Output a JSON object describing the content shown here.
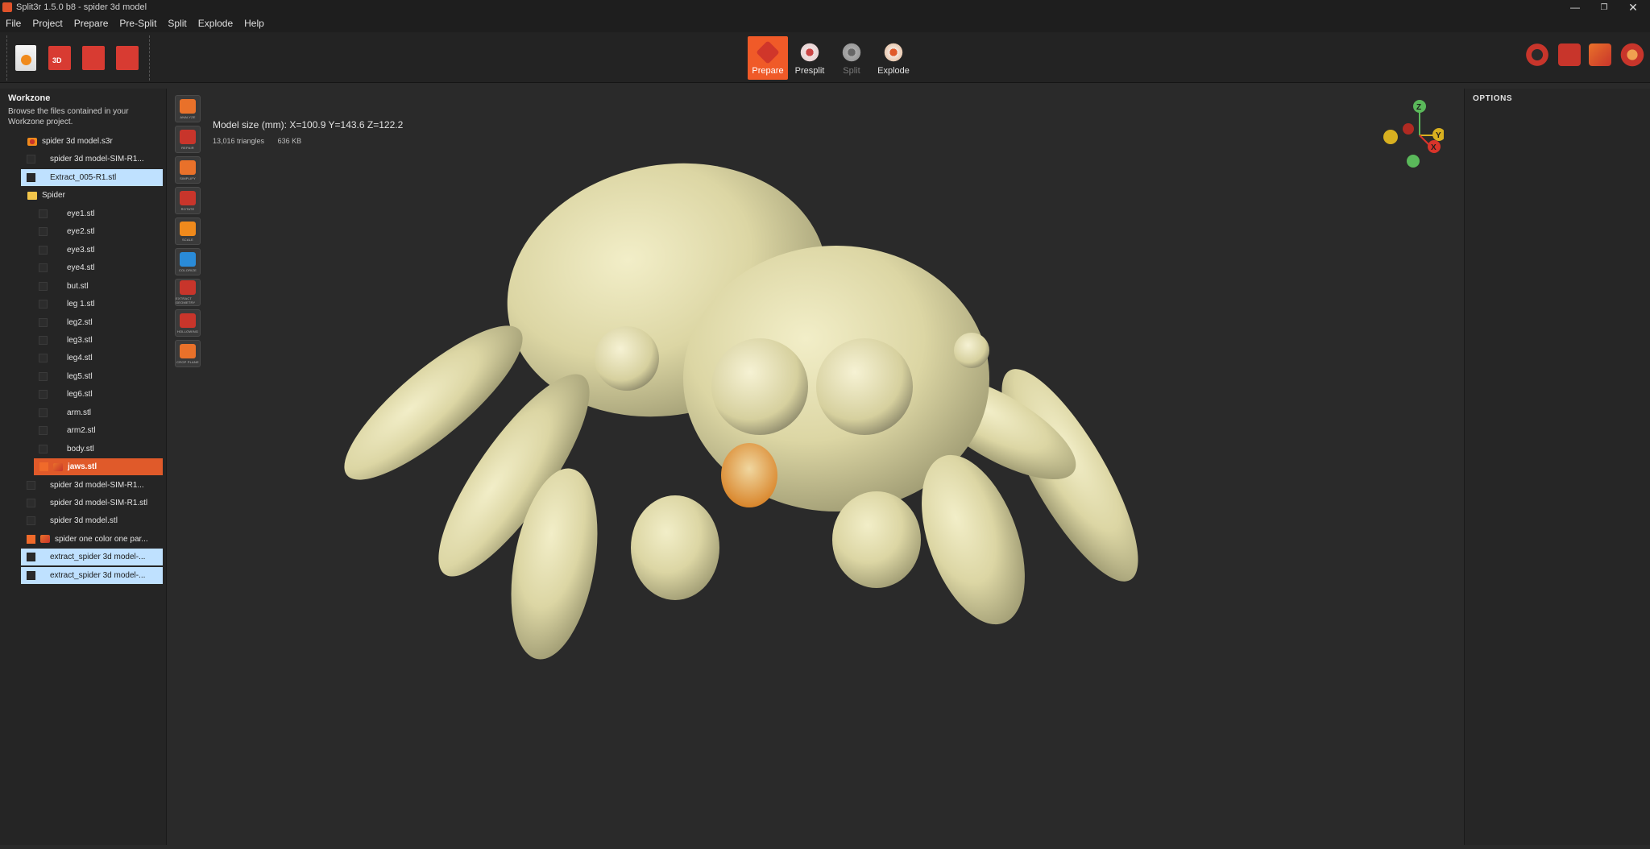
{
  "window": {
    "title": "Split3r 1.5.0 b8 - spider 3d model"
  },
  "menu": [
    "File",
    "Project",
    "Prepare",
    "Pre-Split",
    "Split",
    "Explode",
    "Help"
  ],
  "modes": [
    {
      "label": "Prepare",
      "state": "active"
    },
    {
      "label": "Presplit",
      "state": "normal"
    },
    {
      "label": "Split",
      "state": "disabled"
    },
    {
      "label": "Explode",
      "state": "normal"
    }
  ],
  "sidebar": {
    "title": "Workzone",
    "description": "Browse the files contained in your Workzone project."
  },
  "tree": [
    {
      "label": "spider 3d model.s3r",
      "level": 0,
      "icon": "s3r-file-icon",
      "check": "none",
      "state": "normal"
    },
    {
      "label": "spider 3d model-SIM-R1...",
      "level": 1,
      "icon": "",
      "check": "box",
      "state": "normal"
    },
    {
      "label": "Extract_005-R1.stl",
      "level": 1,
      "icon": "",
      "check": "box",
      "state": "selected"
    },
    {
      "label": "Spider",
      "level": 0,
      "icon": "folder-icon",
      "check": "none",
      "state": "normal"
    },
    {
      "label": "eye1.stl",
      "level": 2,
      "icon": "",
      "check": "box",
      "state": "normal"
    },
    {
      "label": "eye2.stl",
      "level": 2,
      "icon": "",
      "check": "box",
      "state": "normal"
    },
    {
      "label": "eye3.stl",
      "level": 2,
      "icon": "",
      "check": "box",
      "state": "normal"
    },
    {
      "label": "eye4.stl",
      "level": 2,
      "icon": "",
      "check": "box",
      "state": "normal"
    },
    {
      "label": "but.stl",
      "level": 2,
      "icon": "",
      "check": "box",
      "state": "normal"
    },
    {
      "label": "leg 1.stl",
      "level": 2,
      "icon": "",
      "check": "box",
      "state": "normal"
    },
    {
      "label": "leg2.stl",
      "level": 2,
      "icon": "",
      "check": "box",
      "state": "normal"
    },
    {
      "label": "leg3.stl",
      "level": 2,
      "icon": "",
      "check": "box",
      "state": "normal"
    },
    {
      "label": "leg4.stl",
      "level": 2,
      "icon": "",
      "check": "box",
      "state": "normal"
    },
    {
      "label": "leg5.stl",
      "level": 2,
      "icon": "",
      "check": "box",
      "state": "normal"
    },
    {
      "label": "leg6.stl",
      "level": 2,
      "icon": "",
      "check": "box",
      "state": "normal"
    },
    {
      "label": "arm.stl",
      "level": 2,
      "icon": "",
      "check": "box",
      "state": "normal"
    },
    {
      "label": "arm2.stl",
      "level": 2,
      "icon": "",
      "check": "box",
      "state": "normal"
    },
    {
      "label": "body.stl",
      "level": 2,
      "icon": "",
      "check": "box",
      "state": "normal"
    },
    {
      "label": "jaws.stl",
      "level": 2,
      "icon": "package-icon",
      "check": "orange",
      "state": "active"
    },
    {
      "label": "spider 3d model-SIM-R1...",
      "level": 1,
      "icon": "",
      "check": "box",
      "state": "normal"
    },
    {
      "label": "spider 3d model-SIM-R1.stl",
      "level": 1,
      "icon": "",
      "check": "box",
      "state": "normal"
    },
    {
      "label": "spider 3d model.stl",
      "level": 1,
      "icon": "",
      "check": "box",
      "state": "normal"
    },
    {
      "label": "spider one color one par...",
      "level": 1,
      "icon": "package-icon",
      "check": "orange",
      "state": "normal"
    },
    {
      "label": "extract_spider 3d model-...",
      "level": 1,
      "icon": "",
      "check": "box",
      "state": "selected"
    },
    {
      "label": "extract_spider 3d model-...",
      "level": 1,
      "icon": "",
      "check": "box",
      "state": "selected"
    }
  ],
  "tools": [
    {
      "caption": "ANALYZE",
      "icon": "analyze-icon",
      "color": "#e9712a"
    },
    {
      "caption": "REPAIR",
      "icon": "repair-icon",
      "color": "#c8352b"
    },
    {
      "caption": "SIMPLIFY",
      "icon": "simplify-icon",
      "color": "#e9712a"
    },
    {
      "caption": "ROTATE",
      "icon": "rotate-icon",
      "color": "#c8352b"
    },
    {
      "caption": "SCALE",
      "icon": "scale-icon",
      "color": "#f08a1c"
    },
    {
      "caption": "COLORIZE",
      "icon": "colorize-icon",
      "color": "#2a8bd8"
    },
    {
      "caption": "EXTRACT GEOMETRY",
      "icon": "extract-geometry-icon",
      "color": "#c8352b"
    },
    {
      "caption": "HOLLOWING",
      "icon": "hollowing-icon",
      "color": "#c8352b"
    },
    {
      "caption": "CROP PLANE",
      "icon": "crop-plane-icon",
      "color": "#e9712a"
    }
  ],
  "model": {
    "size_text": "Model size (mm): X=100.9 Y=143.6 Z=122.2",
    "triangles": "13,016 triangles",
    "filesize": "636 KB"
  },
  "options": {
    "title": "OPTIONS"
  },
  "axis": {
    "z": "Z",
    "y": "Y",
    "x": "X"
  },
  "colors": {
    "accent": "#f05a28",
    "selection": "#bfe1ff",
    "model": "#e8e3b8"
  }
}
